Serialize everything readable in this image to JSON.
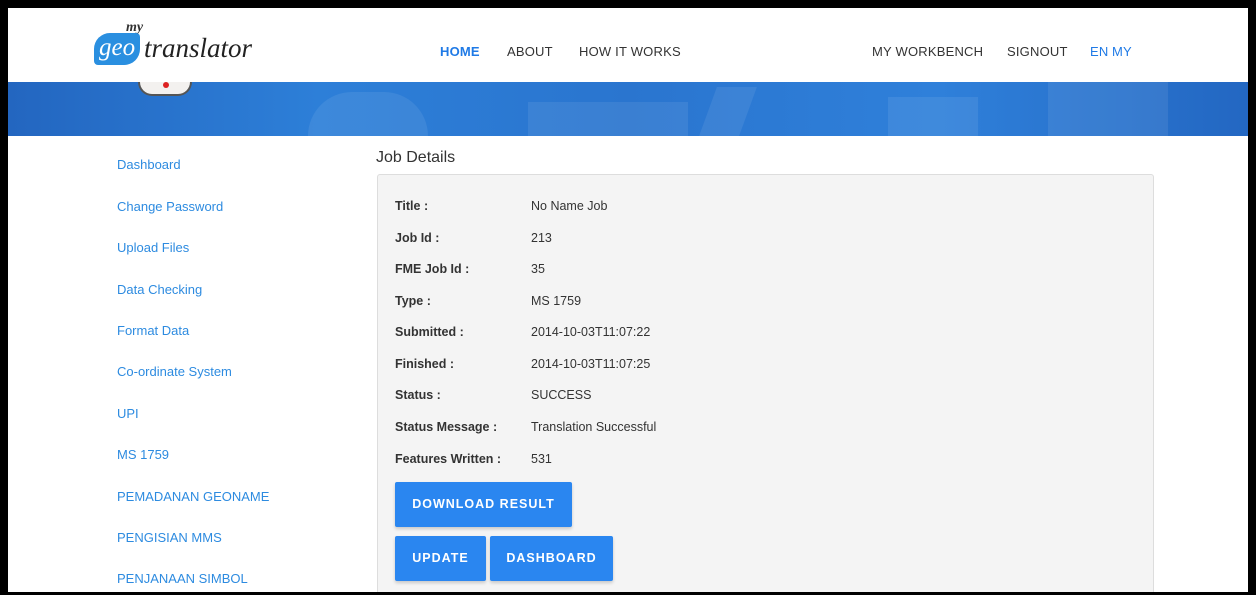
{
  "brand": {
    "my": "my",
    "geo": "geo",
    "translator": "translator"
  },
  "nav": {
    "home": "HOME",
    "about": "ABOUT",
    "how_it_works": "HOW IT WORKS",
    "my_workbench": "MY WORKBENCH",
    "signout": "SIGNOUT",
    "lang_en": "EN",
    "lang_my": "MY"
  },
  "sidebar": {
    "items": [
      "Dashboard",
      "Change Password",
      "Upload Files",
      "Data Checking",
      "Format Data",
      "Co-ordinate System",
      "UPI",
      "MS 1759",
      "PEMADANAN GEONAME",
      "PENGISIAN MMS",
      "PENJANAAN SIMBOL"
    ]
  },
  "page": {
    "title": "Job Details"
  },
  "job": {
    "fields": [
      {
        "label": "Title :",
        "value": "No Name Job"
      },
      {
        "label": "Job Id :",
        "value": "213"
      },
      {
        "label": "FME Job Id :",
        "value": "35"
      },
      {
        "label": "Type :",
        "value": "MS 1759"
      },
      {
        "label": "Submitted :",
        "value": "2014-10-03T11:07:22"
      },
      {
        "label": "Finished :",
        "value": "2014-10-03T11:07:25"
      },
      {
        "label": "Status :",
        "value": "SUCCESS"
      },
      {
        "label": "Status Message :",
        "value": "Translation Successful"
      },
      {
        "label": "Features Written :",
        "value": "531"
      }
    ]
  },
  "buttons": {
    "download": "DOWNLOAD RESULT",
    "update": "UPDATE",
    "dashboard": "DASHBOARD"
  },
  "colors": {
    "accent": "#2a86f0",
    "link": "#2d8be0",
    "banner": "#2a75cf"
  }
}
